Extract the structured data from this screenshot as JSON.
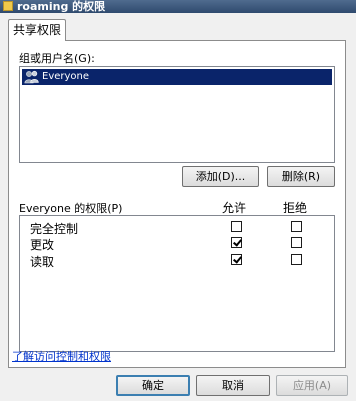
{
  "window": {
    "title": "roaming 的权限"
  },
  "tabs": [
    {
      "label": "共享权限",
      "active": true
    }
  ],
  "groups": {
    "label": "组或用户名(G):",
    "items": [
      {
        "name": "Everyone",
        "selected": true
      }
    ]
  },
  "buttons": {
    "add": "添加(D)...",
    "remove": "删除(R)"
  },
  "permissions": {
    "title": "Everyone 的权限(P)",
    "allow_header": "允许",
    "deny_header": "拒绝",
    "rows": [
      {
        "name": "完全控制",
        "allow": false,
        "deny": false
      },
      {
        "name": "更改",
        "allow": true,
        "deny": false
      },
      {
        "name": "读取",
        "allow": true,
        "deny": false
      }
    ]
  },
  "help_link": "了解访问控制和权限",
  "footer": {
    "ok": "确定",
    "cancel": "取消",
    "apply": "应用(A)"
  },
  "colors": {
    "title_bar": "#2f4a6e",
    "selection": "#0a246a",
    "link": "#0033cc"
  }
}
